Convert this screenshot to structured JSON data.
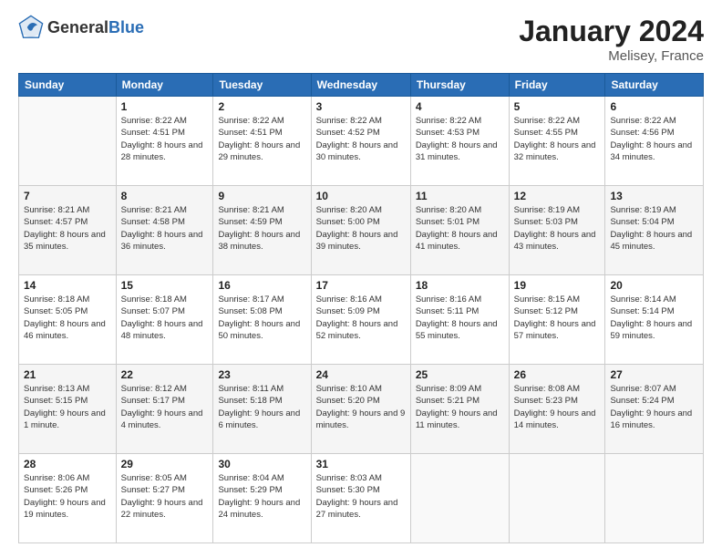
{
  "header": {
    "logo": {
      "general": "General",
      "blue": "Blue"
    },
    "title": "January 2024",
    "location": "Melisey, France"
  },
  "days_of_week": [
    "Sunday",
    "Monday",
    "Tuesday",
    "Wednesday",
    "Thursday",
    "Friday",
    "Saturday"
  ],
  "weeks": [
    [
      {
        "day": "",
        "sunrise": "",
        "sunset": "",
        "daylight": ""
      },
      {
        "day": "1",
        "sunrise": "Sunrise: 8:22 AM",
        "sunset": "Sunset: 4:51 PM",
        "daylight": "Daylight: 8 hours and 28 minutes."
      },
      {
        "day": "2",
        "sunrise": "Sunrise: 8:22 AM",
        "sunset": "Sunset: 4:51 PM",
        "daylight": "Daylight: 8 hours and 29 minutes."
      },
      {
        "day": "3",
        "sunrise": "Sunrise: 8:22 AM",
        "sunset": "Sunset: 4:52 PM",
        "daylight": "Daylight: 8 hours and 30 minutes."
      },
      {
        "day": "4",
        "sunrise": "Sunrise: 8:22 AM",
        "sunset": "Sunset: 4:53 PM",
        "daylight": "Daylight: 8 hours and 31 minutes."
      },
      {
        "day": "5",
        "sunrise": "Sunrise: 8:22 AM",
        "sunset": "Sunset: 4:55 PM",
        "daylight": "Daylight: 8 hours and 32 minutes."
      },
      {
        "day": "6",
        "sunrise": "Sunrise: 8:22 AM",
        "sunset": "Sunset: 4:56 PM",
        "daylight": "Daylight: 8 hours and 34 minutes."
      }
    ],
    [
      {
        "day": "7",
        "sunrise": "Sunrise: 8:21 AM",
        "sunset": "Sunset: 4:57 PM",
        "daylight": "Daylight: 8 hours and 35 minutes."
      },
      {
        "day": "8",
        "sunrise": "Sunrise: 8:21 AM",
        "sunset": "Sunset: 4:58 PM",
        "daylight": "Daylight: 8 hours and 36 minutes."
      },
      {
        "day": "9",
        "sunrise": "Sunrise: 8:21 AM",
        "sunset": "Sunset: 4:59 PM",
        "daylight": "Daylight: 8 hours and 38 minutes."
      },
      {
        "day": "10",
        "sunrise": "Sunrise: 8:20 AM",
        "sunset": "Sunset: 5:00 PM",
        "daylight": "Daylight: 8 hours and 39 minutes."
      },
      {
        "day": "11",
        "sunrise": "Sunrise: 8:20 AM",
        "sunset": "Sunset: 5:01 PM",
        "daylight": "Daylight: 8 hours and 41 minutes."
      },
      {
        "day": "12",
        "sunrise": "Sunrise: 8:19 AM",
        "sunset": "Sunset: 5:03 PM",
        "daylight": "Daylight: 8 hours and 43 minutes."
      },
      {
        "day": "13",
        "sunrise": "Sunrise: 8:19 AM",
        "sunset": "Sunset: 5:04 PM",
        "daylight": "Daylight: 8 hours and 45 minutes."
      }
    ],
    [
      {
        "day": "14",
        "sunrise": "Sunrise: 8:18 AM",
        "sunset": "Sunset: 5:05 PM",
        "daylight": "Daylight: 8 hours and 46 minutes."
      },
      {
        "day": "15",
        "sunrise": "Sunrise: 8:18 AM",
        "sunset": "Sunset: 5:07 PM",
        "daylight": "Daylight: 8 hours and 48 minutes."
      },
      {
        "day": "16",
        "sunrise": "Sunrise: 8:17 AM",
        "sunset": "Sunset: 5:08 PM",
        "daylight": "Daylight: 8 hours and 50 minutes."
      },
      {
        "day": "17",
        "sunrise": "Sunrise: 8:16 AM",
        "sunset": "Sunset: 5:09 PM",
        "daylight": "Daylight: 8 hours and 52 minutes."
      },
      {
        "day": "18",
        "sunrise": "Sunrise: 8:16 AM",
        "sunset": "Sunset: 5:11 PM",
        "daylight": "Daylight: 8 hours and 55 minutes."
      },
      {
        "day": "19",
        "sunrise": "Sunrise: 8:15 AM",
        "sunset": "Sunset: 5:12 PM",
        "daylight": "Daylight: 8 hours and 57 minutes."
      },
      {
        "day": "20",
        "sunrise": "Sunrise: 8:14 AM",
        "sunset": "Sunset: 5:14 PM",
        "daylight": "Daylight: 8 hours and 59 minutes."
      }
    ],
    [
      {
        "day": "21",
        "sunrise": "Sunrise: 8:13 AM",
        "sunset": "Sunset: 5:15 PM",
        "daylight": "Daylight: 9 hours and 1 minute."
      },
      {
        "day": "22",
        "sunrise": "Sunrise: 8:12 AM",
        "sunset": "Sunset: 5:17 PM",
        "daylight": "Daylight: 9 hours and 4 minutes."
      },
      {
        "day": "23",
        "sunrise": "Sunrise: 8:11 AM",
        "sunset": "Sunset: 5:18 PM",
        "daylight": "Daylight: 9 hours and 6 minutes."
      },
      {
        "day": "24",
        "sunrise": "Sunrise: 8:10 AM",
        "sunset": "Sunset: 5:20 PM",
        "daylight": "Daylight: 9 hours and 9 minutes."
      },
      {
        "day": "25",
        "sunrise": "Sunrise: 8:09 AM",
        "sunset": "Sunset: 5:21 PM",
        "daylight": "Daylight: 9 hours and 11 minutes."
      },
      {
        "day": "26",
        "sunrise": "Sunrise: 8:08 AM",
        "sunset": "Sunset: 5:23 PM",
        "daylight": "Daylight: 9 hours and 14 minutes."
      },
      {
        "day": "27",
        "sunrise": "Sunrise: 8:07 AM",
        "sunset": "Sunset: 5:24 PM",
        "daylight": "Daylight: 9 hours and 16 minutes."
      }
    ],
    [
      {
        "day": "28",
        "sunrise": "Sunrise: 8:06 AM",
        "sunset": "Sunset: 5:26 PM",
        "daylight": "Daylight: 9 hours and 19 minutes."
      },
      {
        "day": "29",
        "sunrise": "Sunrise: 8:05 AM",
        "sunset": "Sunset: 5:27 PM",
        "daylight": "Daylight: 9 hours and 22 minutes."
      },
      {
        "day": "30",
        "sunrise": "Sunrise: 8:04 AM",
        "sunset": "Sunset: 5:29 PM",
        "daylight": "Daylight: 9 hours and 24 minutes."
      },
      {
        "day": "31",
        "sunrise": "Sunrise: 8:03 AM",
        "sunset": "Sunset: 5:30 PM",
        "daylight": "Daylight: 9 hours and 27 minutes."
      },
      {
        "day": "",
        "sunrise": "",
        "sunset": "",
        "daylight": ""
      },
      {
        "day": "",
        "sunrise": "",
        "sunset": "",
        "daylight": ""
      },
      {
        "day": "",
        "sunrise": "",
        "sunset": "",
        "daylight": ""
      }
    ]
  ]
}
